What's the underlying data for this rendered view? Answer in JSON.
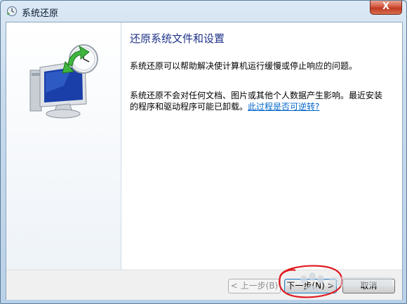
{
  "window": {
    "title": "系统还原",
    "close_label": "X",
    "icon": "system-restore-icon"
  },
  "sidebar": {
    "image": "system-restore-monitor-clock-image"
  },
  "main": {
    "heading": "还原系统文件和设置",
    "paragraph1": "系统还原可以帮助解决使计算机运行缓慢或停止响应的问题。",
    "paragraph2": "系统还原不会对任何文档、图片或其他个人数据产生影响。最近安装的程序和驱动程序可能已卸载。",
    "link": "此过程是否可逆转?"
  },
  "footer": {
    "back_label": "< 上一步(B)",
    "next_label": "下一步(N) >",
    "cancel_label": "取消"
  },
  "colors": {
    "heading": "#1e3287",
    "link": "#0066cc",
    "close_button": "#c03a22",
    "annotation": "#e0191f"
  }
}
